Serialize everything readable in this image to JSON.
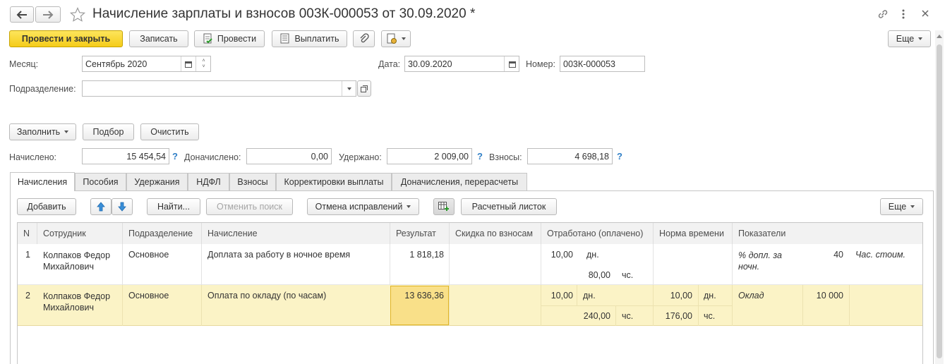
{
  "window": {
    "title": "Начисление зарплаты и взносов 003К-000053 от 30.09.2020 *"
  },
  "toolbar": {
    "post_close": "Провести и закрыть",
    "save": "Записать",
    "post": "Провести",
    "pay": "Выплатить",
    "more": "Еще"
  },
  "header": {
    "month_label": "Месяц:",
    "month_value": "Сентябрь 2020",
    "date_label": "Дата:",
    "date_value": "30.09.2020",
    "number_label": "Номер:",
    "number_value": "003К-000053",
    "department_label": "Подразделение:",
    "department_value": ""
  },
  "actions": {
    "fill": "Заполнить",
    "select": "Подбор",
    "clear": "Очистить"
  },
  "totals": {
    "accrued_label": "Начислено:",
    "accrued_value": "15 454,54",
    "extra_label": "Доначислено:",
    "extra_value": "0,00",
    "withheld_label": "Удержано:",
    "withheld_value": "2 009,00",
    "contrib_label": "Взносы:",
    "contrib_value": "4 698,18",
    "help": "?"
  },
  "tabs": [
    {
      "label": "Начисления"
    },
    {
      "label": "Пособия"
    },
    {
      "label": "Удержания"
    },
    {
      "label": "НДФЛ"
    },
    {
      "label": "Взносы"
    },
    {
      "label": "Корректировки выплаты"
    },
    {
      "label": "Доначисления, перерасчеты"
    }
  ],
  "table_toolbar": {
    "add": "Добавить",
    "find": "Найти...",
    "cancel_search": "Отменить поиск",
    "cancel_corrections": "Отмена исправлений",
    "payslip": "Расчетный листок",
    "more": "Еще"
  },
  "table": {
    "columns": [
      "N",
      "Сотрудник",
      "Подразделение",
      "Начисление",
      "Результат",
      "Скидка по взносам",
      "Отработано (оплачено)",
      "Норма времени",
      "Показатели"
    ],
    "rows": [
      {
        "n": "1",
        "employee": "Колпаков Федор Михайлович",
        "department": "Основное",
        "accrual": "Доплата за работу в ночное время",
        "result": "1 818,18",
        "worked_days": "10,00",
        "worked_days_unit": "дн.",
        "worked_hours": "80,00",
        "worked_hours_unit": "чс.",
        "norm_days": "",
        "norm_days_unit": "",
        "norm_hours": "",
        "norm_hours_unit": "",
        "indicator_name": "% допл. за ночн.",
        "indicator_value": "40",
        "indicator2_name": "Час. стоим."
      },
      {
        "n": "2",
        "employee": "Колпаков Федор Михайлович",
        "department": "Основное",
        "accrual": "Оплата по окладу (по часам)",
        "result": "13 636,36",
        "worked_days": "10,00",
        "worked_days_unit": "дн.",
        "worked_hours": "240,00",
        "worked_hours_unit": "чс.",
        "norm_days": "10,00",
        "norm_days_unit": "дн.",
        "norm_hours": "176,00",
        "norm_hours_unit": "чс.",
        "indicator_name": "Оклад",
        "indicator_value": "10 000",
        "indicator2_name": ""
      }
    ]
  },
  "colors": {
    "primary_button": "#f5cc19",
    "selected_row": "#fbf3c6",
    "selected_cell": "#f9e089",
    "help_blue": "#2f7fc6"
  }
}
